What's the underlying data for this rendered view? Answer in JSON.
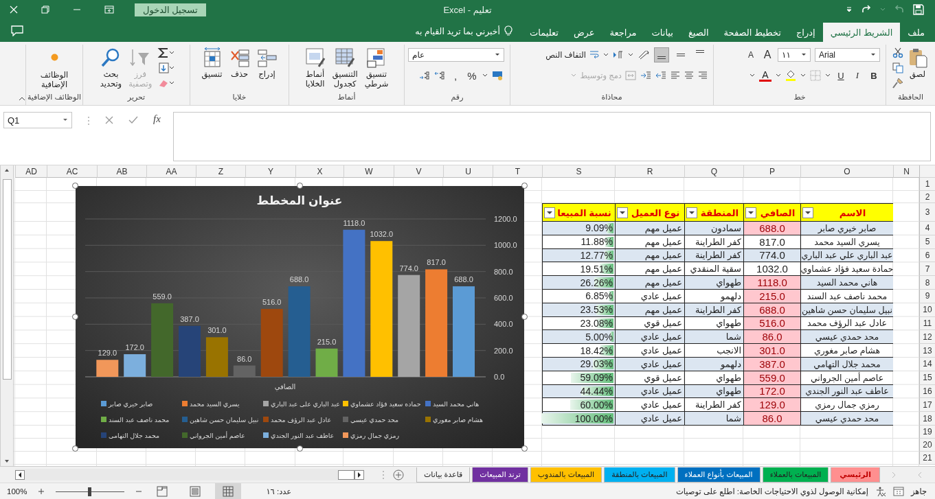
{
  "title_bar": {
    "title": "تعليم - Excel",
    "sign_in": "تسجيل الدخول"
  },
  "ribbon_tabs": [
    {
      "label": "ملف",
      "selected": false
    },
    {
      "label": "الشريط الرئيسي",
      "selected": true
    },
    {
      "label": "إدراج",
      "selected": false
    },
    {
      "label": "تخطيط الصفحة",
      "selected": false
    },
    {
      "label": "الصيغ",
      "selected": false
    },
    {
      "label": "بيانات",
      "selected": false
    },
    {
      "label": "مراجعة",
      "selected": false
    },
    {
      "label": "عرض",
      "selected": false
    },
    {
      "label": "تعليمات",
      "selected": false
    }
  ],
  "tell_me": "أخبرني بما تريد القيام به",
  "ribbon": {
    "clipboard": {
      "label": "الحافظة",
      "paste": "لصق"
    },
    "font": {
      "label": "خط",
      "family": "Arial",
      "size": "١١",
      "grow": "A",
      "shrink": "A",
      "bold": "B",
      "italic": "I",
      "underline": "U",
      "font_color": "A"
    },
    "alignment": {
      "label": "محاذاة",
      "vertical_align": [
        {
          "selected": false
        },
        {
          "selected": false
        },
        {
          "selected": true
        }
      ],
      "wrap": "التفاف النص",
      "merge": {
        "label": "دمج وتوسيط",
        "disabled": true
      }
    },
    "number": {
      "label": "رقم",
      "format": "عام",
      "percent": "%",
      "comma": ","
    },
    "styles": {
      "label": "أنماط",
      "conditional": "تنسيق\nشرطي",
      "table": "التنسيق\nكجدول",
      "cell": "أنماط\nالخلايا"
    },
    "cells": {
      "label": "خلايا",
      "insert": "إدراج",
      "delete": "حذف",
      "format": "تنسيق"
    },
    "editing": {
      "label": "تحرير",
      "sort": {
        "label": "فرز\nوتصفية",
        "disabled": true
      },
      "find": "بحث\nوتحديد"
    },
    "addins": {
      "label": "الوظائف الإضافية",
      "button": "الوظائف\nالإضافية"
    }
  },
  "formula_bar": {
    "name_box": "Q1",
    "function_label": "fx"
  },
  "sheet": {
    "columns": [
      "N",
      "O",
      "P",
      "Q",
      "R",
      "S",
      "T",
      "U",
      "V",
      "W",
      "X",
      "Y",
      "Z",
      "AA",
      "AB",
      "AC",
      "AD"
    ],
    "rows": [
      "1",
      "2",
      "3",
      "4",
      "5",
      "6",
      "7",
      "8",
      "9",
      "10",
      "11",
      "12",
      "13",
      "14",
      "15",
      "16",
      "17",
      "18",
      "19",
      "20",
      "21"
    ]
  },
  "table": {
    "headers": [
      "الاسم",
      "الصافي",
      "المنطقة",
      "نوع العميل",
      "نسبة المبيعا"
    ],
    "rows": [
      {
        "name": "صابر خيري صابر",
        "net": "688.0",
        "highlighted": true,
        "region": "سمادون",
        "type": "عميل مهم",
        "share": "9.09%",
        "level": 0.0909
      },
      {
        "name": "يسري السيد محمد",
        "net": "817.0",
        "highlighted": false,
        "region": "كفر الطراينة",
        "type": "عميل مهم",
        "share": "11.88%",
        "level": 0.1188
      },
      {
        "name": "عبد الباري علي عبد الباري",
        "net": "774.0",
        "highlighted": false,
        "region": "كفر الطراينة",
        "type": "عميل مهم",
        "share": "12.77%",
        "level": 0.1277
      },
      {
        "name": "حمادة سعيد فؤاد عشماوي",
        "net": "1032.0",
        "highlighted": false,
        "region": "سقية المنقدي",
        "type": "عميل مهم",
        "share": "19.51%",
        "level": 0.1951
      },
      {
        "name": "هاني محمد السيد",
        "net": "1118.0",
        "highlighted": true,
        "region": "طهواي",
        "type": "عميل مهم",
        "share": "26.26%",
        "level": 0.2626
      },
      {
        "name": "محمد ناصف عبد السند",
        "net": "215.0",
        "highlighted": true,
        "region": "دلهمو",
        "type": "عميل عادي",
        "share": "6.85%",
        "level": 0.0685
      },
      {
        "name": "نبيل سليمان حسن شاهين",
        "net": "688.0",
        "highlighted": true,
        "region": "كفر الطراينة",
        "type": "عميل مهم",
        "share": "23.53%",
        "level": 0.2353
      },
      {
        "name": "عادل عبد الرؤف محمد",
        "net": "516.0",
        "highlighted": true,
        "region": "طهواي",
        "type": "عميل قوي",
        "share": "23.08%",
        "level": 0.2308
      },
      {
        "name": "محد حمدي عيسي",
        "net": "86.0",
        "highlighted": true,
        "region": "شما",
        "type": "عميل عادي",
        "share": "5.00%",
        "level": 0.05
      },
      {
        "name": "هشام صابر مغوري",
        "net": "301.0",
        "highlighted": true,
        "region": "الانجب",
        "type": "عميل عادي",
        "share": "18.42%",
        "level": 0.1842
      },
      {
        "name": "محمد جلال التهامي",
        "net": "387.0",
        "highlighted": true,
        "region": "دلهمو",
        "type": "عميل عادي",
        "share": "29.03%",
        "level": 0.2903
      },
      {
        "name": "عاصم أمين الجرواني",
        "net": "559.0",
        "highlighted": true,
        "region": "طهواي",
        "type": "عميل قوي",
        "share": "59.09%",
        "level": 0.5909
      },
      {
        "name": "عاطف عبد النور الجندي",
        "net": "172.0",
        "highlighted": true,
        "region": "طهواي",
        "type": "عميل عادي",
        "share": "44.44%",
        "level": 0.4444
      },
      {
        "name": "رمزي جمال رمزي",
        "net": "129.0",
        "highlighted": true,
        "region": "كفر الطراينة",
        "type": "عميل عادي",
        "share": "60.00%",
        "level": 0.6
      },
      {
        "name": "محد حمدي عيسي",
        "net": "86.0",
        "highlighted": true,
        "region": "شما",
        "type": "عميل عادي",
        "share": "100.00%",
        "level": 1.0
      }
    ]
  },
  "chart": {
    "chart_data": {
      "type": "bar",
      "title": "عنوان المخطط",
      "categories": [
        "الصافي"
      ],
      "data_labels": true,
      "grid": true,
      "legend": true,
      "ylim": [
        0,
        1200
      ],
      "yticks": [
        {
          "value": 0,
          "label": "0.0"
        },
        {
          "value": 200,
          "label": "200.0"
        },
        {
          "value": 400,
          "label": "400.0"
        },
        {
          "value": 600,
          "label": "600.0"
        },
        {
          "value": 800,
          "label": "800.0"
        },
        {
          "value": 1000,
          "label": "1000.0"
        },
        {
          "value": 1200,
          "label": "1200.0"
        }
      ],
      "series": [
        {
          "name": "صابر خيري صابر",
          "color": "#5b9bd5",
          "values": [
            688
          ],
          "value_labels": [
            "688.0"
          ]
        },
        {
          "name": "يسري السيد محمد",
          "color": "#ed7d31",
          "values": [
            817
          ],
          "value_labels": [
            "817.0"
          ]
        },
        {
          "name": "عبد الباري على عبد الباري",
          "color": "#a5a5a5",
          "values": [
            774
          ],
          "value_labels": [
            "774.0"
          ]
        },
        {
          "name": "حماده سعيد فؤاد عشماوي",
          "color": "#ffc000",
          "values": [
            1032
          ],
          "value_labels": [
            "1032.0"
          ]
        },
        {
          "name": "هاني محمد السيد",
          "color": "#4472c4",
          "values": [
            1118
          ],
          "value_labels": [
            "1118.0"
          ]
        },
        {
          "name": "محمد ناصف عبد السند",
          "color": "#70ad47",
          "values": [
            215
          ],
          "value_labels": [
            "215.0"
          ]
        },
        {
          "name": "نبيل سليمان حسن شاهين",
          "color": "#255e91",
          "values": [
            688
          ],
          "value_labels": [
            "688.0"
          ]
        },
        {
          "name": "عادل عبد الرؤف محمد",
          "color": "#9e480e",
          "values": [
            516
          ],
          "value_labels": [
            "516.0"
          ]
        },
        {
          "name": "محد حمدي عيسي",
          "color": "#636363",
          "values": [
            86
          ],
          "value_labels": [
            "86.0"
          ]
        },
        {
          "name": "هشام صابر مغوري",
          "color": "#997300",
          "values": [
            301
          ],
          "value_labels": [
            "301.0"
          ]
        },
        {
          "name": "محمد جلال التهامى",
          "color": "#264478",
          "values": [
            387
          ],
          "value_labels": [
            "387.0"
          ]
        },
        {
          "name": "عاصم أمين الجرواني",
          "color": "#43682b",
          "values": [
            559
          ],
          "value_labels": [
            "559.0"
          ]
        },
        {
          "name": "عاطف عبد النور الجندي",
          "color": "#7cafdd",
          "values": [
            172
          ],
          "value_labels": [
            "172.0"
          ]
        },
        {
          "name": "رمزي جمال رمزي",
          "color": "#f1975a",
          "values": [
            129
          ],
          "value_labels": [
            "129.0"
          ]
        }
      ]
    }
  },
  "sheet_tabs": [
    {
      "label": "الرئيسي",
      "selected": true,
      "color": "#ff8f8f"
    },
    {
      "label": "المبيعات بالعملاء",
      "selected": false,
      "color": "#00b050"
    },
    {
      "label": "المبيعات بأنواع العملاء",
      "selected": false,
      "color": "#0070c0"
    },
    {
      "label": "المبيعات بالمنطقة",
      "selected": false,
      "color": "#00b0f0"
    },
    {
      "label": "المبيعات بالمندوب",
      "selected": false,
      "color": "#ffc000"
    },
    {
      "label": "ترند المبيعات",
      "selected": false,
      "color": "#7030a0"
    },
    {
      "label": "قاعدة بيانات",
      "selected": false
    }
  ],
  "status_bar": {
    "ready": "جاهز",
    "accessibility": "إمكانية الوصول لذوي الاحتياجات الخاصة: اطلع على توصيات",
    "count": "عدد: ١٦",
    "views": [
      {
        "selected": true
      },
      {
        "selected": false
      },
      {
        "selected": false
      }
    ],
    "zoom_slider": {
      "level": 0.5
    },
    "zoom": "100%"
  }
}
